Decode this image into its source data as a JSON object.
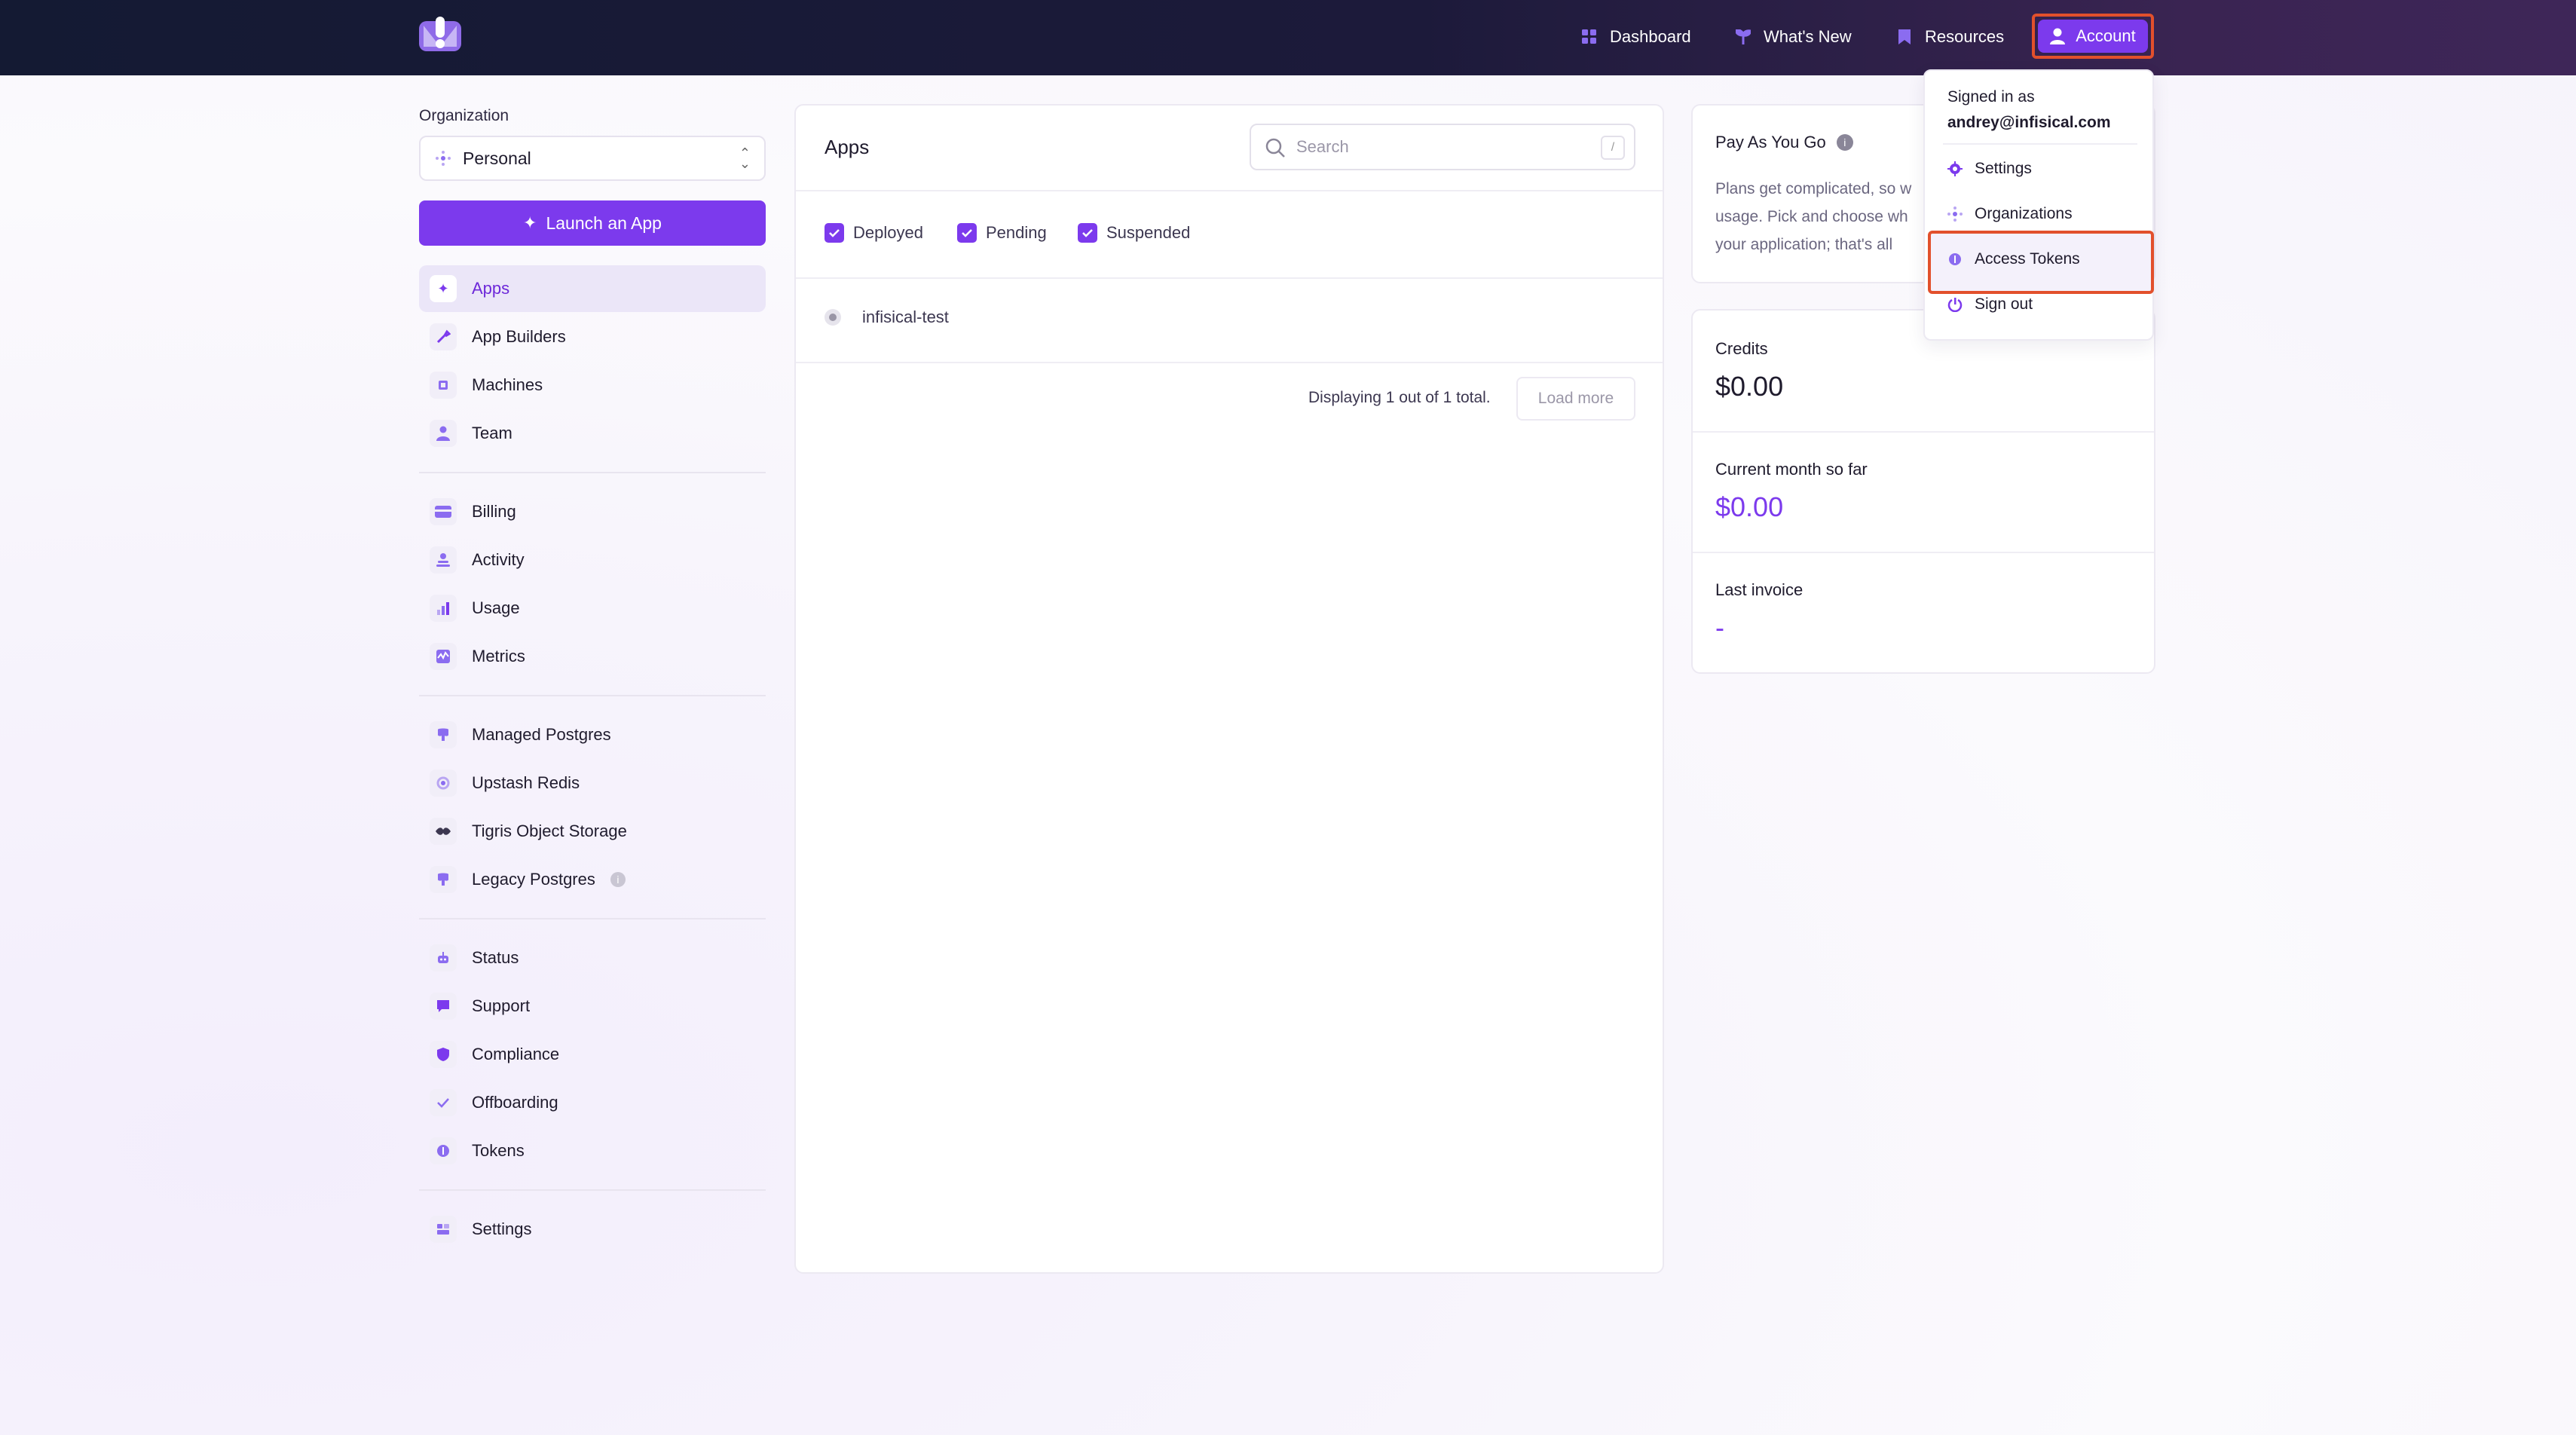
{
  "topbar": {
    "nav": [
      {
        "label": "Dashboard",
        "icon": "grid-icon"
      },
      {
        "label": "What's New",
        "icon": "sprout-icon"
      },
      {
        "label": "Resources",
        "icon": "bookmark-icon"
      }
    ],
    "account_label": "Account"
  },
  "sidebar": {
    "org_label": "Organization",
    "org_value": "Personal",
    "launch_label": "Launch an App",
    "group1": [
      "Apps",
      "App Builders",
      "Machines",
      "Team"
    ],
    "group2": [
      "Billing",
      "Activity",
      "Usage",
      "Metrics"
    ],
    "group3": [
      "Managed Postgres",
      "Upstash Redis",
      "Tigris Object Storage",
      "Legacy Postgres"
    ],
    "group4": [
      "Status",
      "Support",
      "Compliance",
      "Offboarding",
      "Tokens"
    ],
    "group5": [
      "Settings"
    ]
  },
  "apps": {
    "title": "Apps",
    "search_placeholder": "Search",
    "search_shortcut": "/",
    "filters": [
      "Deployed",
      "Pending",
      "Suspended"
    ],
    "rows": [
      "infisical-test"
    ],
    "displaying": "Displaying 1 out of 1 total.",
    "load_more": "Load more"
  },
  "billing": {
    "pay_title": "Pay As You Go",
    "pay_desc_lines": [
      "Plans get complicated, so w",
      "usage. Pick and choose wh",
      "your application; that's all"
    ],
    "credits_label": "Credits",
    "credits_value": "$0.00",
    "month_label": "Current month so far",
    "month_value": "$0.00",
    "invoice_label": "Last invoice",
    "invoice_value": "-"
  },
  "account_menu": {
    "signed_in_as": "Signed in as",
    "email": "andrey@infisical.com",
    "items": [
      "Settings",
      "Organizations",
      "Access Tokens",
      "Sign out"
    ]
  },
  "colors": {
    "accent": "#7c3aed",
    "highlight": "#e2502c"
  }
}
